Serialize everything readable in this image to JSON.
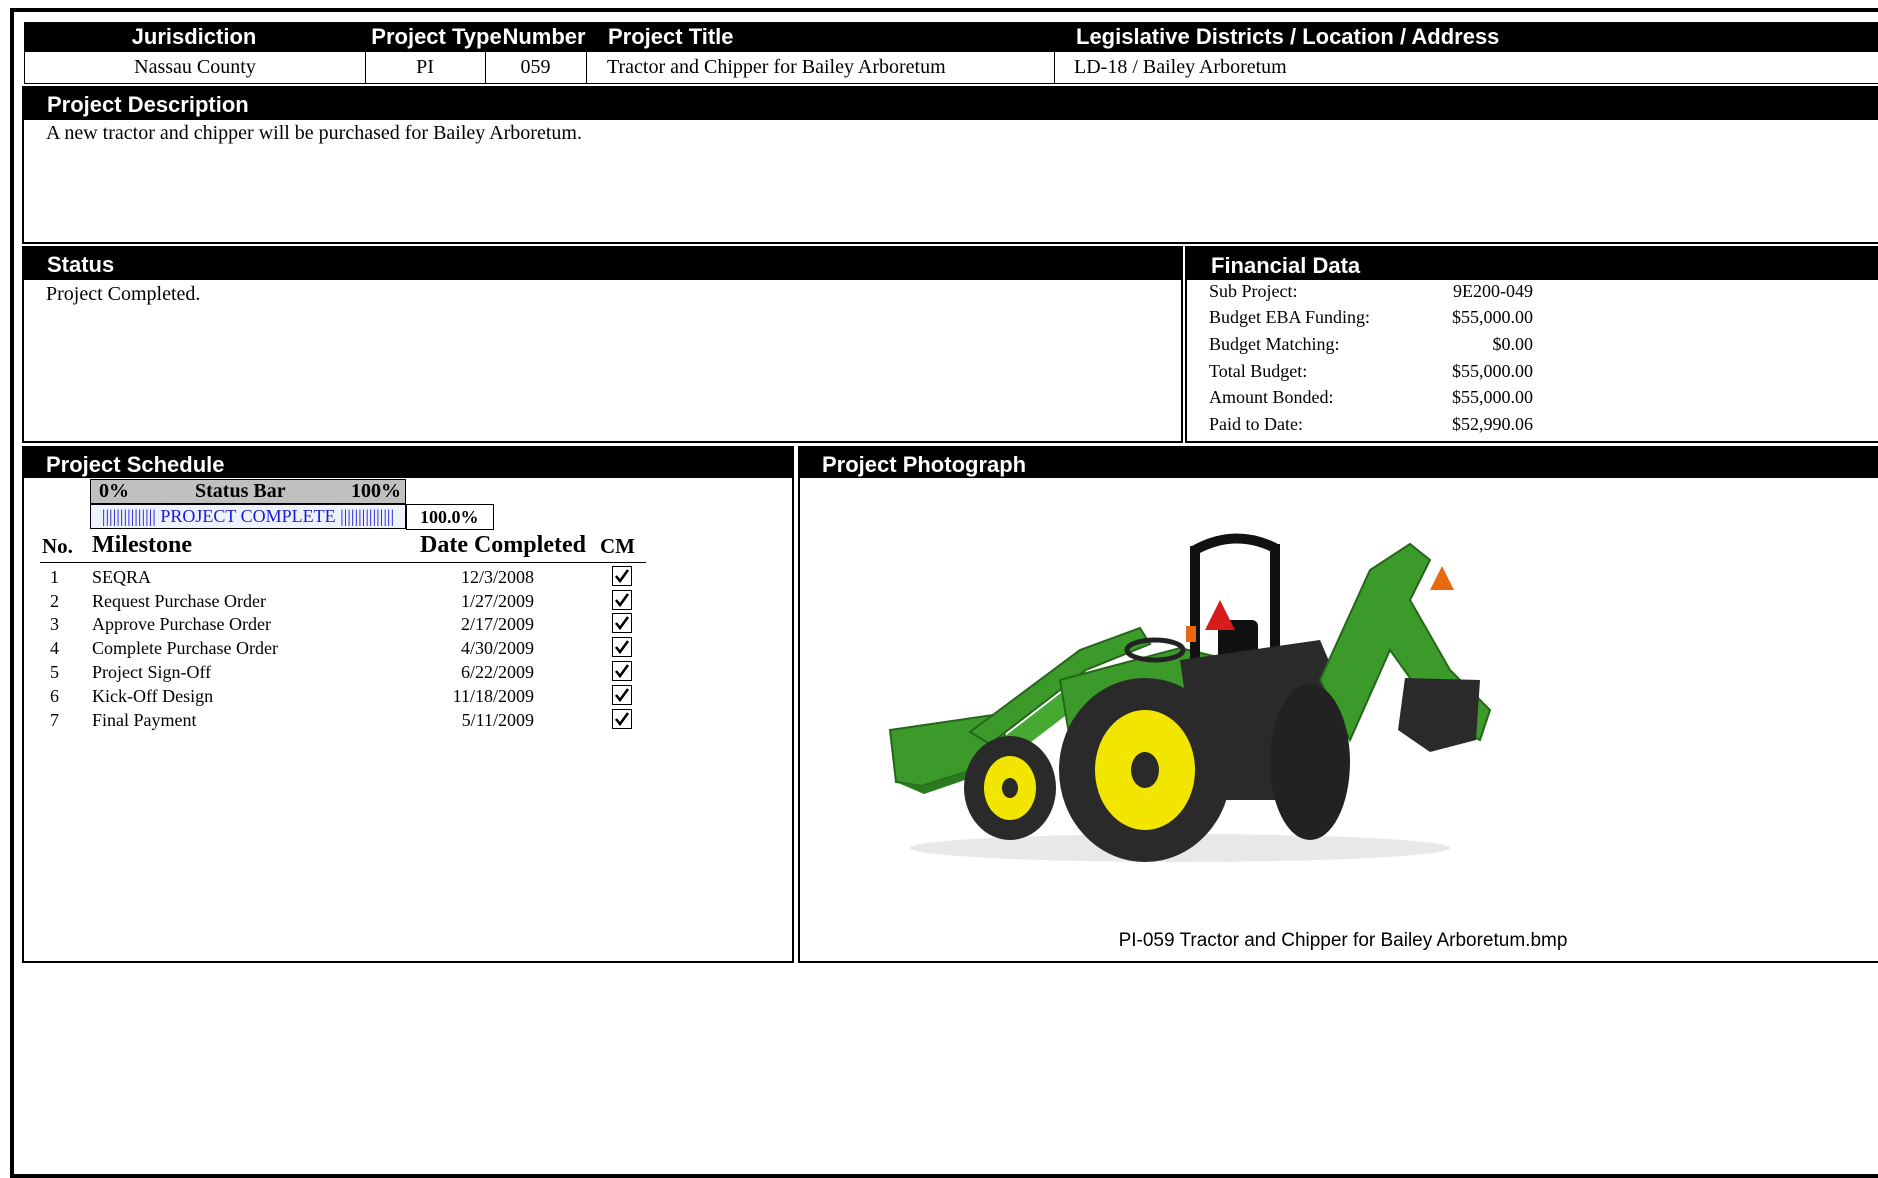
{
  "header": {
    "labels": {
      "jurisdiction": "Jurisdiction",
      "project_type": "Project Type",
      "number": "Number",
      "project_title": "Project Title",
      "location": "Legislative Districts / Location / Address"
    },
    "values": {
      "jurisdiction": "Nassau County",
      "project_type": "PI",
      "number": "059",
      "project_title": "Tractor and Chipper for Bailey Arboretum",
      "location": "LD-18 / Bailey Arboretum"
    }
  },
  "description": {
    "heading": "Project Description",
    "text": "A new tractor and chipper will be purchased for Bailey Arboretum."
  },
  "status": {
    "heading": "Status",
    "text": "Project Completed."
  },
  "financial": {
    "heading": "Financial Data",
    "rows": [
      {
        "label": "Sub Project:",
        "value": "9E200-049"
      },
      {
        "label": "Budget EBA Funding:",
        "value": "$55,000.00"
      },
      {
        "label": "Budget Matching:",
        "value": "$0.00"
      },
      {
        "label": "Total Budget:",
        "value": "$55,000.00"
      },
      {
        "label": "Amount Bonded:",
        "value": "$55,000.00"
      },
      {
        "label": "Paid to Date:",
        "value": "$52,990.06"
      }
    ]
  },
  "schedule": {
    "heading": "Project Schedule",
    "status_bar": {
      "left": "0%",
      "title": "Status Bar",
      "right": "100%",
      "fill_text": "||||||||||||||| PROJECT COMPLETE |||||||||||||||",
      "percent_text": "100.0%",
      "percent": 100
    },
    "columns": {
      "no": "No.",
      "milestone": "Milestone",
      "date": "Date Completed",
      "cm": "CM"
    },
    "rows": [
      {
        "no": "1",
        "milestone": "SEQRA",
        "date": "12/3/2008",
        "cm": true
      },
      {
        "no": "2",
        "milestone": "Request Purchase Order",
        "date": "1/27/2009",
        "cm": true
      },
      {
        "no": "3",
        "milestone": "Approve Purchase Order",
        "date": "2/17/2009",
        "cm": true
      },
      {
        "no": "4",
        "milestone": "Complete Purchase Order",
        "date": "4/30/2009",
        "cm": true
      },
      {
        "no": "5",
        "milestone": "Project Sign-Off",
        "date": "6/22/2009",
        "cm": true
      },
      {
        "no": "6",
        "milestone": "Kick-Off Design",
        "date": "11/18/2009",
        "cm": true
      },
      {
        "no": "7",
        "milestone": "Final Payment",
        "date": "5/11/2009",
        "cm": true
      }
    ]
  },
  "photo": {
    "heading": "Project Photograph",
    "caption": "PI-059 Tractor and Chipper for Bailey Arboretum.bmp",
    "icon": "tractor-photo",
    "colors": {
      "body": "#3c9a2a",
      "wheel": "#f2e600",
      "tire": "#2a2a2a",
      "seat": "#111111",
      "reflector": "#e86a10",
      "light": "#d81c1c"
    }
  }
}
